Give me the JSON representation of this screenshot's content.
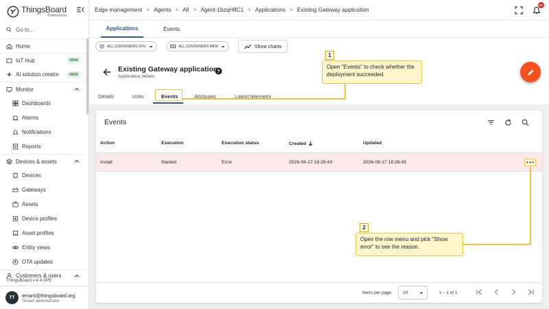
{
  "sidebar": {
    "logo_name": "ThingsBoard",
    "logo_sub": "Professional",
    "goto_placeholder": "Go to...",
    "items": [
      {
        "label": "Home"
      },
      {
        "label": "IoT Hub",
        "badge": "NEW"
      },
      {
        "label": "AI solution creator",
        "badge": "NEW"
      },
      {
        "label": "Monitor"
      },
      {
        "label": "Dashboards"
      },
      {
        "label": "Alarms"
      },
      {
        "label": "Notifications"
      },
      {
        "label": "Reports"
      },
      {
        "label": "Devices & assets"
      },
      {
        "label": "Devices"
      },
      {
        "label": "Gateways"
      },
      {
        "label": "Assets"
      },
      {
        "label": "Device profiles"
      },
      {
        "label": "Asset profiles"
      },
      {
        "label": "Entity views"
      },
      {
        "label": "OTA updates"
      },
      {
        "label": "Customers & users"
      }
    ],
    "version": "ThingsBoard v.4.4.0PE",
    "user": {
      "initials": "TT",
      "email": "tenant@thingsboard.org",
      "role": "Tenant administrator"
    }
  },
  "breadcrumb": [
    "Edge management",
    "Agents",
    "All",
    "Agent-1bzqH8C1",
    "Applications",
    "Existing Gateway application"
  ],
  "topbar": {
    "notification_count": "99+"
  },
  "top_tabs": [
    "Applications",
    "Events"
  ],
  "filters": {
    "chip1": "ALL CONTAINERS CPU",
    "chip2": "ALL CONTAINERS MEM",
    "show_charts": "Show charts"
  },
  "details": {
    "title": "Existing Gateway application",
    "subtitle": "Application details",
    "tabs": [
      "Details",
      "Units",
      "Events",
      "Attributes",
      "Latest telemetry"
    ],
    "active_tab": "Events"
  },
  "events": {
    "title": "Events",
    "columns": [
      "Action",
      "Execution",
      "Execution status",
      "Created",
      "Updated"
    ],
    "rows": [
      {
        "action": "Install",
        "execution": "Started",
        "status": "Error",
        "created": "2026-08-17 18:26:43",
        "updated": "2026-08-17 18:26:45"
      }
    ],
    "pager": {
      "items_per_page_label": "Items per page:",
      "items_per_page": "10",
      "range": "1 – 1 of 1"
    }
  },
  "callouts": [
    {
      "num": "1",
      "text": "Open \"Events\" to check whether the deployment succeeded."
    },
    {
      "num": "2",
      "text": "Open the row menu and pick \"Show error\" to see the reason."
    }
  ],
  "colors": {
    "primary": "#305680",
    "fab": "#f4511e",
    "error_row": "#fbe9e9",
    "callout_border": "#f2c23b",
    "callout_bg": "#fff6cd"
  }
}
